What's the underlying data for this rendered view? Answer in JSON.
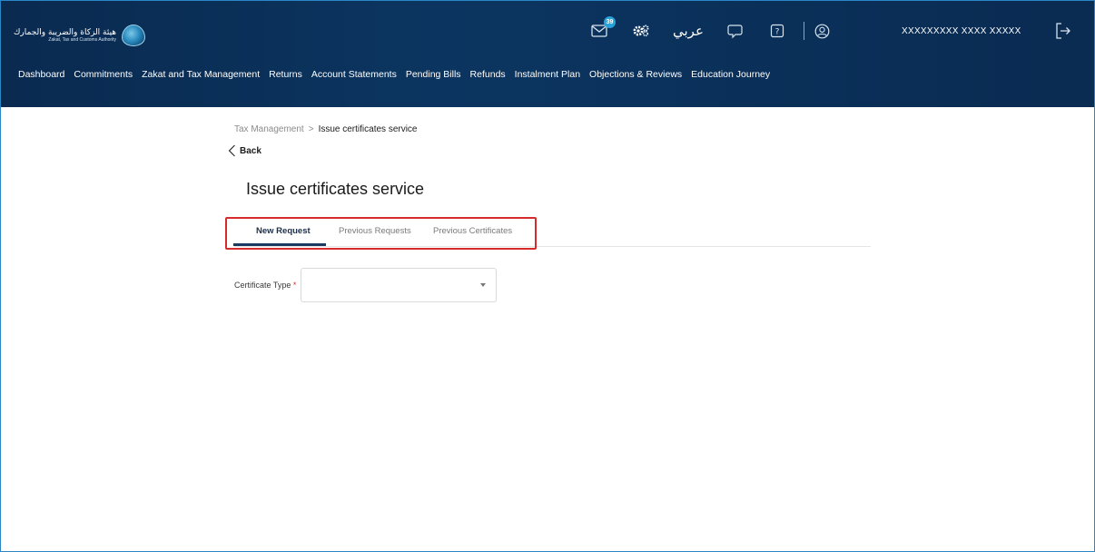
{
  "header": {
    "logo": {
      "arabic_name": "هيئة الزكاة والضريبة والجمارك",
      "english_name": "Zakat, Tax and Customs Authority",
      "icon": "zatca-logo"
    },
    "notifications": {
      "icon": "mail-icon",
      "count": "39"
    },
    "settings_icon": "gear-icon",
    "language_label": "عربي",
    "chat_icon": "chat-icon",
    "help_icon": "help-icon",
    "profile_icon": "user-circle-icon",
    "user_name": "XXXXXXXXX XXXX XXXXX",
    "logout_icon": "logout-icon",
    "nav": [
      "Dashboard",
      "Commitments",
      "Zakat and Tax Management",
      "Returns",
      "Account Statements",
      "Pending Bills",
      "Refunds",
      "Instalment Plan",
      "Objections & Reviews",
      "Education Journey"
    ]
  },
  "breadcrumb": {
    "parent": "Tax Management",
    "separator": ">",
    "current": "Issue certificates service"
  },
  "back_label": "Back",
  "page_title": "Issue certificates service",
  "tabs": [
    {
      "label": "New Request",
      "active": true
    },
    {
      "label": "Previous Requests",
      "active": false
    },
    {
      "label": "Previous Certificates",
      "active": false
    }
  ],
  "form": {
    "certificate_type": {
      "label": "Certificate Type",
      "required_marker": "*",
      "value": ""
    }
  },
  "colors": {
    "header_bg": "#0b2a52",
    "tab_active": "#1a3a62",
    "highlight_border": "#d52b2b",
    "required": "#d32f2f"
  }
}
